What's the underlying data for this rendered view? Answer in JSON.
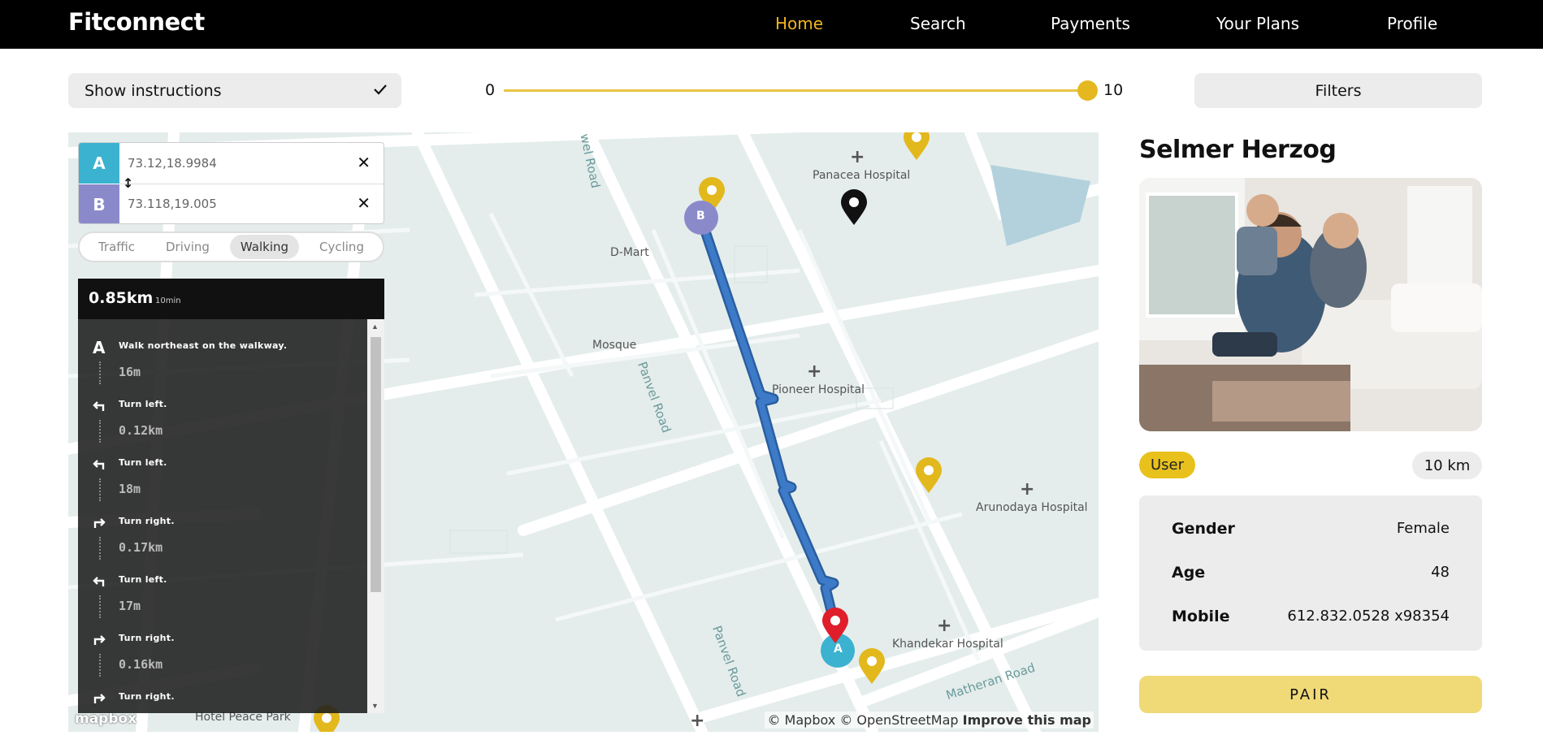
{
  "nav": {
    "logo": "Fitconnect",
    "links": [
      "Home",
      "Search",
      "Payments",
      "Your Plans",
      "Profile"
    ],
    "active_index": 0,
    "active_color": "#f0b51e"
  },
  "toolbar": {
    "instructions_label": "Show instructions",
    "instructions_checked": true,
    "range_min": "0",
    "range_max": "10",
    "range_value": 10,
    "filters_label": "Filters"
  },
  "directions": {
    "origin_letter": "A",
    "origin_value": "73.12,18.9984",
    "destination_letter": "B",
    "destination_value": "73.118,19.005",
    "profiles": [
      "Traffic",
      "Driving",
      "Walking",
      "Cycling"
    ],
    "active_profile": "Walking",
    "summary_distance": "0.85km",
    "summary_duration": "10min",
    "steps": [
      {
        "icon": "origin-a-icon",
        "text": "Walk northeast on the walkway.",
        "distance": "16m"
      },
      {
        "icon": "turn-left-icon",
        "text": "Turn left.",
        "distance": "0.12km"
      },
      {
        "icon": "turn-left-icon",
        "text": "Turn left.",
        "distance": "18m"
      },
      {
        "icon": "turn-right-icon",
        "text": "Turn right.",
        "distance": "0.17km"
      },
      {
        "icon": "turn-left-icon",
        "text": "Turn left.",
        "distance": "17m"
      },
      {
        "icon": "turn-right-icon",
        "text": "Turn right.",
        "distance": "0.16km"
      },
      {
        "icon": "turn-right-icon",
        "text": "Turn right.",
        "distance": ""
      }
    ]
  },
  "map": {
    "labels": {
      "panacea": "Panacea Hospital",
      "dmart": "D-Mart",
      "mosque": "Mosque",
      "pioneer": "Pioneer Hospital",
      "arunodaya": "Arunodaya Hospital",
      "khandekar": "Khandekar Hospital",
      "peace_park": "Hotel Peace Park",
      "panvel_1": "Panvel Road",
      "panvel_2": "Panvel Road",
      "panvel_top": "wel Road",
      "matheran": "Matheran Road"
    },
    "route_marker_a": "A",
    "route_marker_b": "B",
    "attribution": {
      "mapbox": "© Mapbox",
      "osm": "© OpenStreetMap",
      "improve": "Improve this map"
    },
    "logo": "mapbox",
    "route_color": "#3d7bc8",
    "pin_color": "#e2b81c",
    "selected_pin_color": "#e01e2b"
  },
  "profile": {
    "name": "Selmer Herzog",
    "role": "User",
    "distance": "10 km",
    "details": [
      {
        "key": "Gender",
        "value": "Female"
      },
      {
        "key": "Age",
        "value": "48"
      },
      {
        "key": "Mobile",
        "value": "612.832.0528 x98354"
      }
    ],
    "pair_label": "PAIR"
  }
}
